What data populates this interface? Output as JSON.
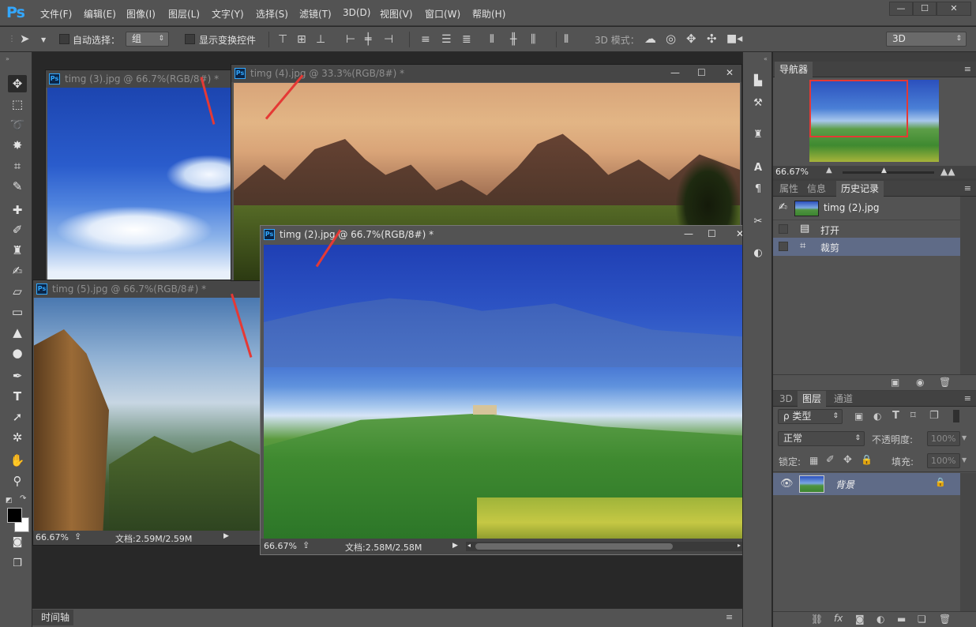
{
  "app": {
    "logo": "Ps",
    "menus": [
      "文件(F)",
      "编辑(E)",
      "图像(I)",
      "图层(L)",
      "文字(Y)",
      "选择(S)",
      "滤镜(T)",
      "3D(D)",
      "视图(V)",
      "窗口(W)",
      "帮助(H)"
    ],
    "window_controls": [
      "—",
      "☐",
      "✕"
    ]
  },
  "options": {
    "auto_select_label": "自动选择：",
    "auto_select_value": "组",
    "show_transform_label": "显示变换控件",
    "mode_3d_label": "3D 模式：",
    "workspace_value": "3D"
  },
  "documents": {
    "timg3": {
      "title": "timg (3).jpg @ 66.7%(RGB/8#) *"
    },
    "timg4": {
      "title": "timg (4).jpg @ 33.3%(RGB/8#) *"
    },
    "timg5": {
      "title": "timg (5).jpg @ 66.7%(RGB/8#) *",
      "zoom": "66.67%",
      "doc_info": "文档:2.59M/2.59M"
    },
    "timg2": {
      "title": "timg (2).jpg @ 66.7%(RGB/8#) *",
      "zoom": "66.67%",
      "doc_info": "文档:2.58M/2.58M"
    }
  },
  "navigator": {
    "tab": "导航器",
    "zoom": "66.67%"
  },
  "history_panel": {
    "tabs": [
      "属性",
      "信息",
      "历史记录"
    ],
    "snapshot_name": "timg (2).jpg",
    "steps": [
      "打开",
      "裁剪"
    ]
  },
  "layers_panel": {
    "tabs": [
      "3D",
      "图层",
      "通道"
    ],
    "filter_kind": "ρ 类型",
    "blend_mode": "正常",
    "opacity_label": "不透明度:",
    "opacity_value": "100%",
    "lock_label": "锁定:",
    "fill_label": "填充:",
    "fill_value": "100%",
    "layers": [
      {
        "name": "背景"
      }
    ]
  },
  "timeline": {
    "label": "时间轴"
  },
  "colors": {
    "accent": "#31a8ff",
    "annotation_arrow": "#e53935",
    "layer_selected": "#5f6b87"
  }
}
